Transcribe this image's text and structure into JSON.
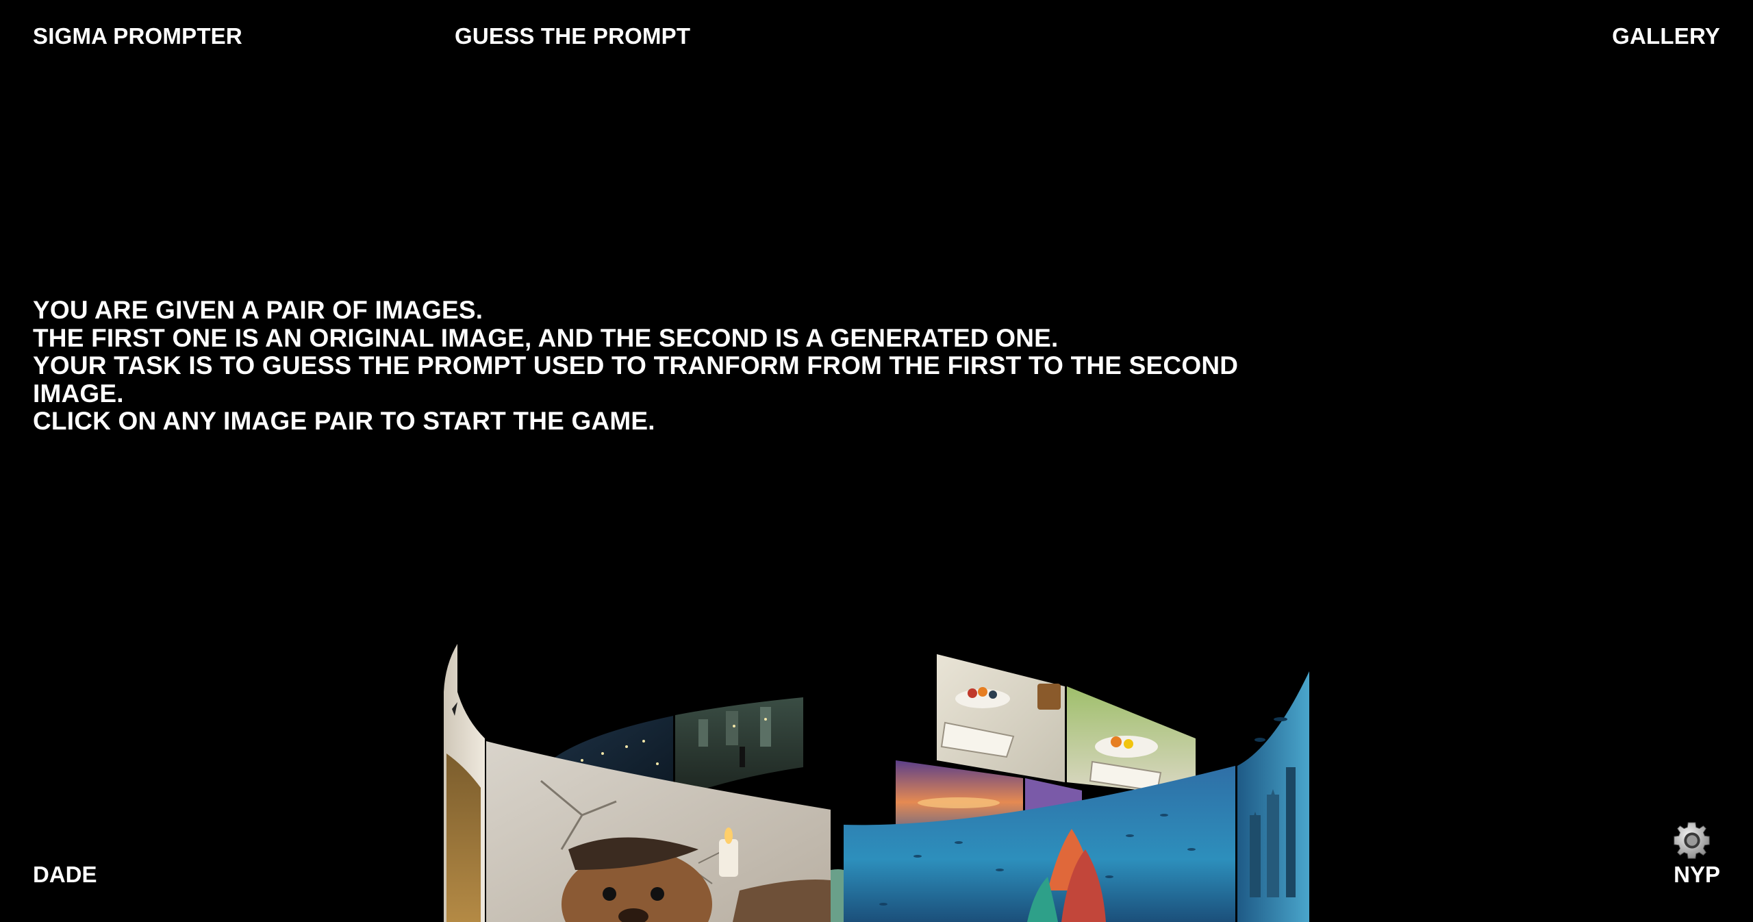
{
  "nav": {
    "brand": "SIGMA PROMPTER",
    "guess": "GUESS THE PROMPT",
    "gallery": "GALLERY"
  },
  "instructions": [
    "YOU ARE GIVEN A PAIR OF IMAGES.",
    "THE FIRST ONE IS AN ORIGINAL IMAGE, AND THE SECOND IS A GENERATED ONE.",
    "YOUR TASK IS TO GUESS THE PROMPT USED TO TRANFORM FROM THE FIRST TO THE SECOND",
    "IMAGE.",
    "CLICK ON ANY IMAGE PAIR TO START THE GAME."
  ],
  "footer": {
    "left": "DADE",
    "right": "NYP"
  },
  "icons": {
    "settings": "gear-icon"
  },
  "colors": {
    "background": "#000000",
    "text": "#ffffff"
  }
}
